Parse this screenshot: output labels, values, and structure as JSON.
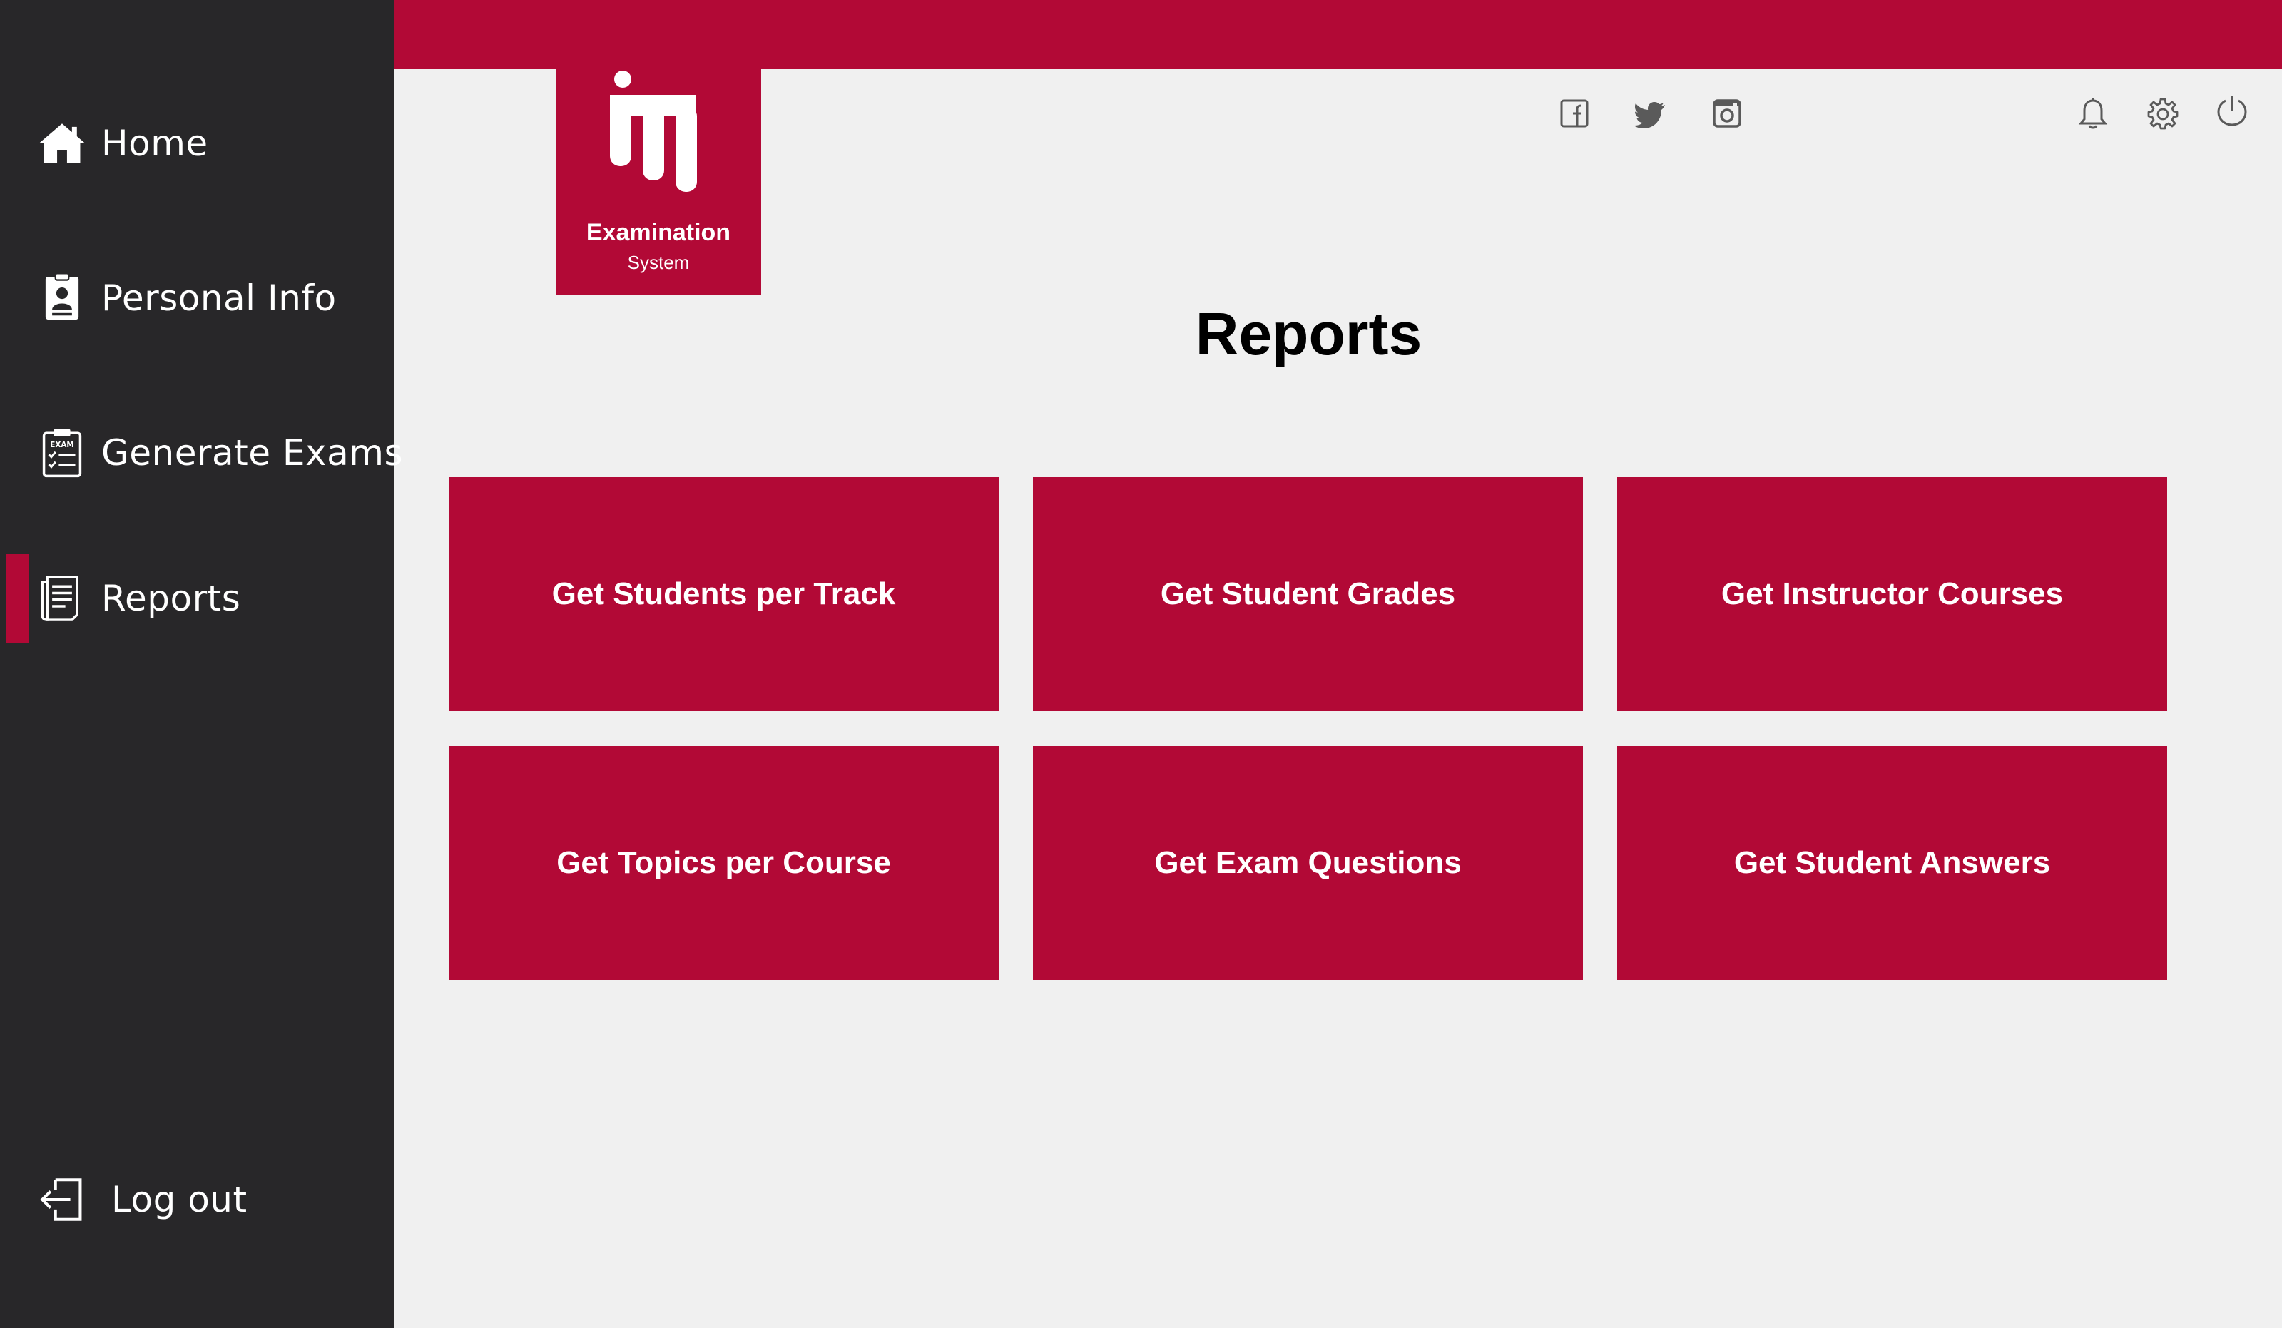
{
  "sidebar": {
    "items": [
      {
        "label": "Home",
        "icon": "home-icon"
      },
      {
        "label": "Personal Info",
        "icon": "id-card-icon"
      },
      {
        "label": "Generate Exams",
        "icon": "exam-clipboard-icon"
      },
      {
        "label": "Reports",
        "icon": "report-document-icon",
        "active": true
      }
    ],
    "logout_label": "Log out"
  },
  "logo": {
    "title": "Examination",
    "subtitle": "System",
    "mark": "iti"
  },
  "header": {
    "social_icons": [
      "facebook-icon",
      "twitter-icon",
      "instagram-icon"
    ],
    "action_icons": [
      "bell-icon",
      "gear-icon",
      "power-icon"
    ]
  },
  "main": {
    "title": "Reports",
    "tiles": [
      {
        "label": "Get Students per Track"
      },
      {
        "label": "Get Student Grades"
      },
      {
        "label": "Get Instructor Courses"
      },
      {
        "label": "Get Topics per Course"
      },
      {
        "label": "Get Exam Questions"
      },
      {
        "label": "Get Student Answers"
      }
    ]
  },
  "colors": {
    "accent": "#b20936",
    "sidebar_bg": "#282729",
    "page_bg": "#f0f0f0",
    "icon_gray": "#5a5a5a"
  }
}
